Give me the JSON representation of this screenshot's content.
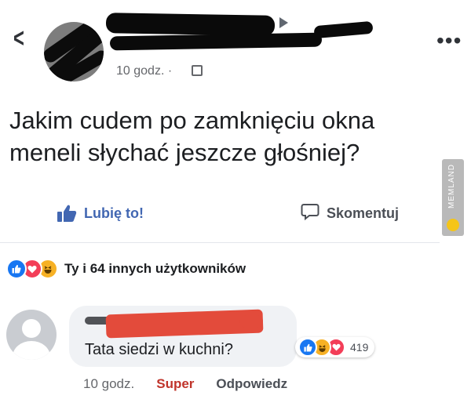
{
  "header": {
    "back_icon": "chevron-left-icon",
    "more_icon": "more-horizontal-icon",
    "timestamp": "10 godz.",
    "separator": "·",
    "audience_icon": "friends-icon"
  },
  "post": {
    "text": "Jakim cudem po zamknięciu okna meneli słychać jeszcze głośniej?"
  },
  "watermark": {
    "text": "MEMLAND"
  },
  "actions": {
    "like_label": "Lubię to!",
    "comment_label": "Skomentuj"
  },
  "reactions_summary": {
    "icons": [
      "like",
      "love",
      "haha"
    ],
    "text": "Ty i 64 innych użytkowników"
  },
  "comment": {
    "text": "Tata siedzi w kuchni?",
    "reactions": [
      "like",
      "haha",
      "love"
    ],
    "reaction_count": "419",
    "time": "10 godz.",
    "reaction_label": "Super",
    "reply_label": "Odpowiedz"
  },
  "colors": {
    "link_blue": "#4267b2",
    "like_blue": "#1877f2",
    "love_red": "#f33e58",
    "haha_yellow": "#f7b125",
    "super_red": "#c0342b"
  }
}
